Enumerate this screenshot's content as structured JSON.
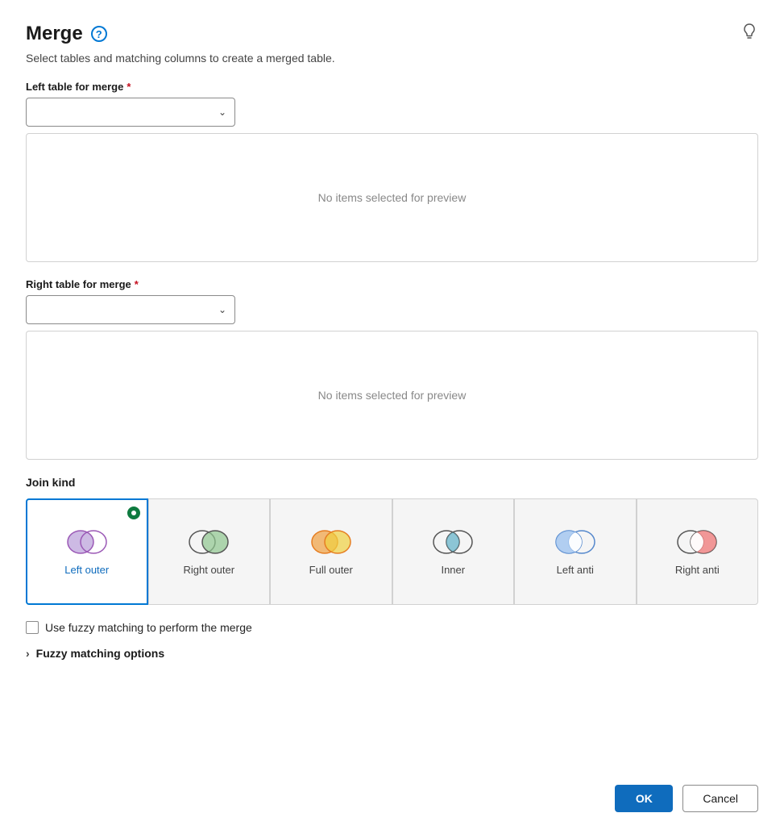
{
  "header": {
    "title": "Merge",
    "subtitle": "Select tables and matching columns to create a merged table.",
    "help_icon_label": "?",
    "lightbulb_icon": "💡"
  },
  "left_table": {
    "label": "Left table for merge",
    "required": true,
    "placeholder": "",
    "preview_text": "No items selected for preview"
  },
  "right_table": {
    "label": "Right table for merge",
    "required": true,
    "placeholder": "",
    "preview_text": "No items selected for preview"
  },
  "join_kind": {
    "label": "Join kind",
    "options": [
      {
        "id": "left-outer",
        "label": "Left outer",
        "selected": true
      },
      {
        "id": "right-outer",
        "label": "Right outer",
        "selected": false
      },
      {
        "id": "full-outer",
        "label": "Full outer",
        "selected": false
      },
      {
        "id": "inner",
        "label": "Inner",
        "selected": false
      },
      {
        "id": "left-anti",
        "label": "Left anti",
        "selected": false
      },
      {
        "id": "right-anti",
        "label": "Right anti",
        "selected": false
      }
    ]
  },
  "fuzzy_matching": {
    "checkbox_label": "Use fuzzy matching to perform the merge",
    "options_label": "Fuzzy matching options"
  },
  "footer": {
    "ok_label": "OK",
    "cancel_label": "Cancel"
  }
}
